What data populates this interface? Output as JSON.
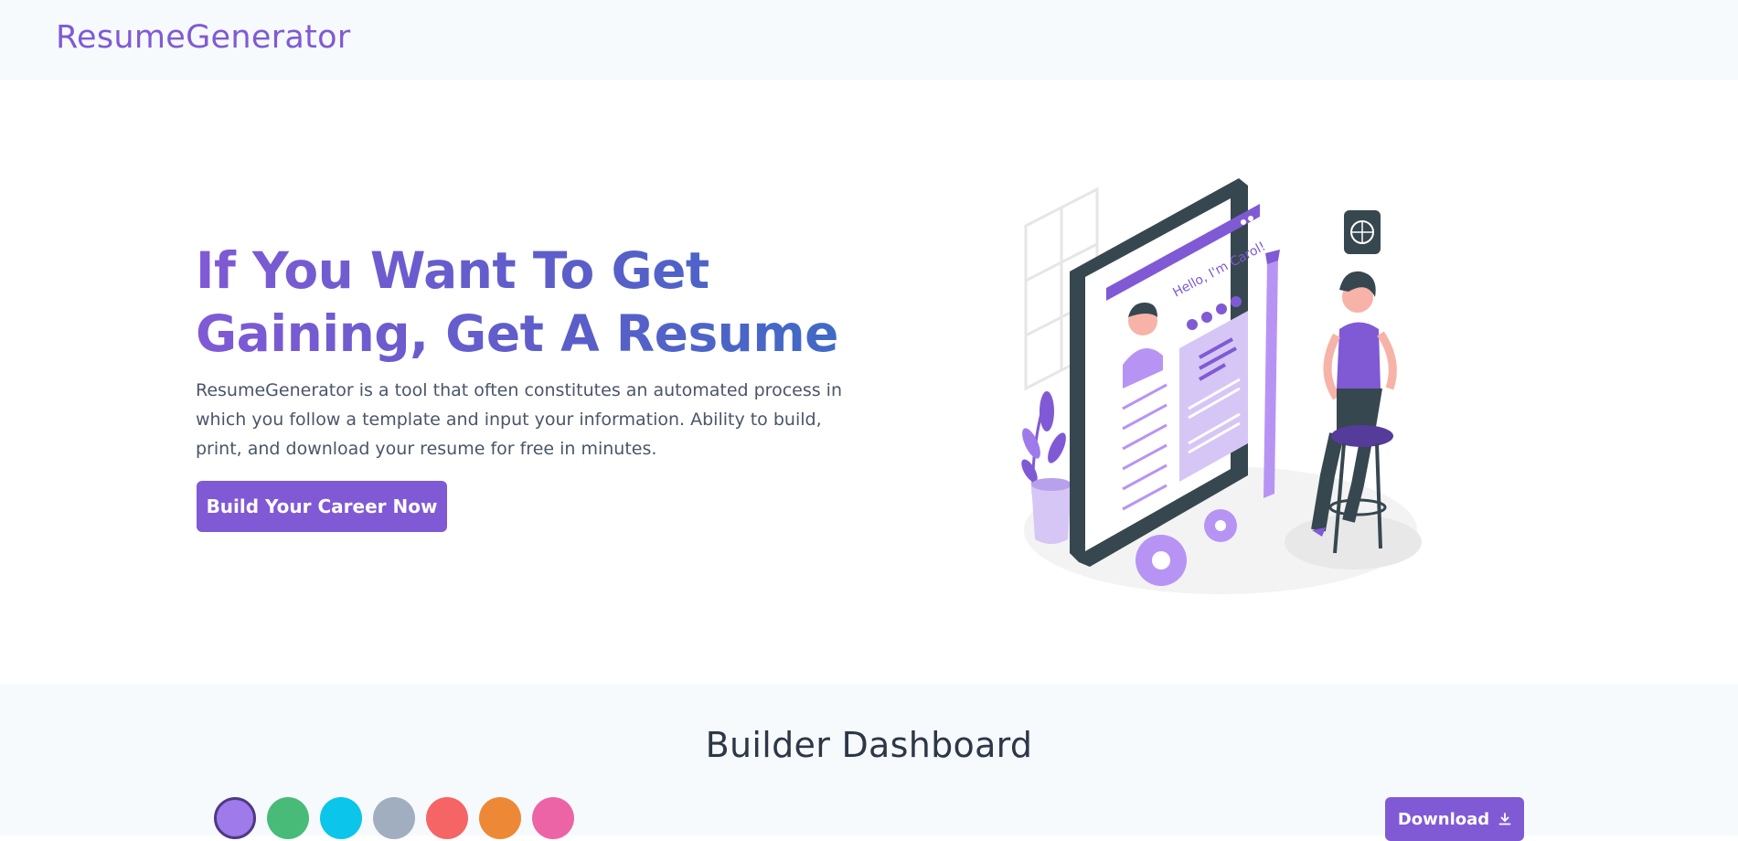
{
  "navbar": {
    "brand": "ResumeGenerator"
  },
  "hero": {
    "title": "If You Want To Get Gaining, Get A Resume",
    "description": "ResumeGenerator is a tool that often constitutes an automated process in which you follow a template and input your information. Ability to build, print, and download your resume for free in minutes.",
    "cta_label": "Build Your Career Now",
    "illustration": {
      "phone_greeting": "Hello, I'm Carol!"
    }
  },
  "dashboard": {
    "title": "Builder Dashboard",
    "download_label": "Download",
    "download_icon": "download-icon",
    "theme_colors": [
      {
        "name": "purple",
        "color": "#9f7aea",
        "selected": true
      },
      {
        "name": "green",
        "color": "#48bb78",
        "selected": false
      },
      {
        "name": "cyan",
        "color": "#0bc5ea",
        "selected": false
      },
      {
        "name": "gray",
        "color": "#a0aec0",
        "selected": false
      },
      {
        "name": "red",
        "color": "#f56565",
        "selected": false
      },
      {
        "name": "orange",
        "color": "#ed8936",
        "selected": false
      },
      {
        "name": "pink",
        "color": "#ed64a6",
        "selected": false
      }
    ]
  },
  "colors": {
    "accent": "#805ad5",
    "navbar_bg": "#f7fafc",
    "text": "#2d3748"
  }
}
